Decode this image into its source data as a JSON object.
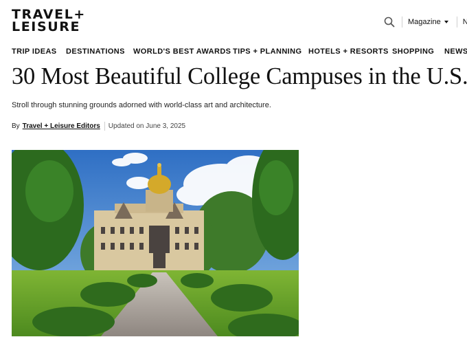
{
  "brand": {
    "logo_line1": "TRAVEL+",
    "logo_line2": "LEISURE"
  },
  "header": {
    "magazine_label": "Magazine",
    "newsletter_label": "Ne"
  },
  "nav": {
    "items": [
      {
        "label": "TRIP IDEAS"
      },
      {
        "label": "DESTINATIONS"
      },
      {
        "label": "WORLD'S BEST AWARDS"
      },
      {
        "label": "TIPS + PLANNING"
      },
      {
        "label": "HOTELS + RESORTS"
      },
      {
        "label": "SHOPPING"
      },
      {
        "label": "NEWS"
      }
    ]
  },
  "article": {
    "title": "30 Most Beautiful College Campuses in the U.S.",
    "subtitle": "Stroll through stunning grounds adorned with world-class art and architecture.",
    "byline_prefix": "By",
    "author": "Travel + Leisure Editors",
    "updated": "Updated on June 3, 2025"
  },
  "icons": {
    "search": "search-icon",
    "caret": "chevron-down-icon"
  },
  "colors": {
    "text": "#111111",
    "divider": "#cfcfcf"
  }
}
